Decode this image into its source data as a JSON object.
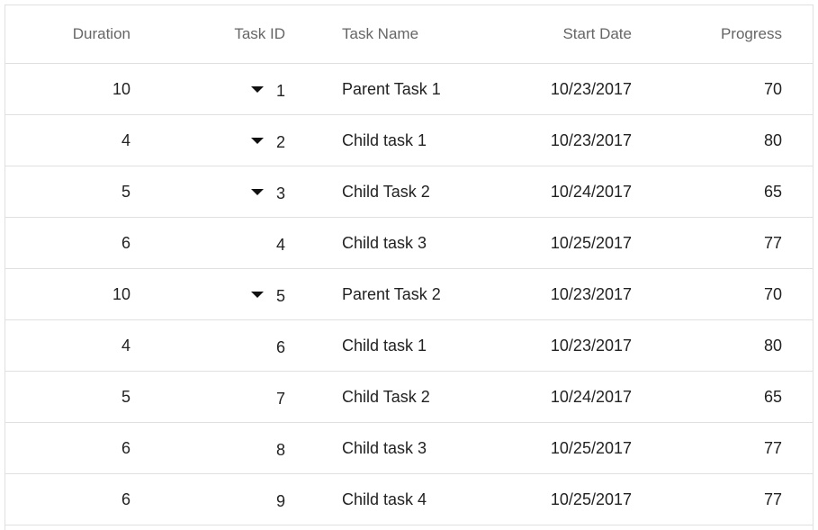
{
  "columns": {
    "duration": "Duration",
    "task_id": "Task ID",
    "task_name": "Task Name",
    "start_date": "Start Date",
    "progress": "Progress"
  },
  "rows": [
    {
      "duration": "10",
      "task_id": "1",
      "task_name": "Parent Task 1",
      "start_date": "10/23/2017",
      "progress": "70",
      "expandable": true
    },
    {
      "duration": "4",
      "task_id": "2",
      "task_name": "Child task 1",
      "start_date": "10/23/2017",
      "progress": "80",
      "expandable": true
    },
    {
      "duration": "5",
      "task_id": "3",
      "task_name": "Child Task 2",
      "start_date": "10/24/2017",
      "progress": "65",
      "expandable": true
    },
    {
      "duration": "6",
      "task_id": "4",
      "task_name": "Child task 3",
      "start_date": "10/25/2017",
      "progress": "77",
      "expandable": false
    },
    {
      "duration": "10",
      "task_id": "5",
      "task_name": "Parent Task 2",
      "start_date": "10/23/2017",
      "progress": "70",
      "expandable": true
    },
    {
      "duration": "4",
      "task_id": "6",
      "task_name": "Child task 1",
      "start_date": "10/23/2017",
      "progress": "80",
      "expandable": false
    },
    {
      "duration": "5",
      "task_id": "7",
      "task_name": "Child Task 2",
      "start_date": "10/24/2017",
      "progress": "65",
      "expandable": false
    },
    {
      "duration": "6",
      "task_id": "8",
      "task_name": "Child task 3",
      "start_date": "10/25/2017",
      "progress": "77",
      "expandable": false
    },
    {
      "duration": "6",
      "task_id": "9",
      "task_name": "Child task 4",
      "start_date": "10/25/2017",
      "progress": "77",
      "expandable": false
    }
  ],
  "icons": {
    "expand": "caret-down-icon"
  }
}
